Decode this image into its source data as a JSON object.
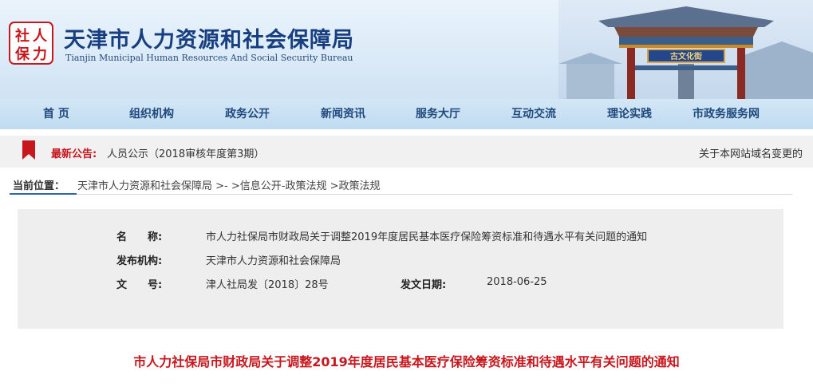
{
  "header": {
    "logo_text": "社人保力",
    "title": "天津市人力资源和社会保障局",
    "subtitle": "Tianjin Municipal Human Resources And Social Security Bureau",
    "gate_sign": "古文化街"
  },
  "nav": {
    "items": [
      {
        "label": "首 页"
      },
      {
        "label": "组织机构"
      },
      {
        "label": "政务公开"
      },
      {
        "label": "新闻资讯"
      },
      {
        "label": "服务大厅"
      },
      {
        "label": "互动交流"
      },
      {
        "label": "理论实践"
      },
      {
        "label": "市政务服务网"
      }
    ]
  },
  "notice": {
    "label": "最新公告:",
    "text": "人员公示（2018审核年度第3期）",
    "text2": "关于本网站域名变更的"
  },
  "breadcrumb": {
    "label": "当前位置：",
    "home": "天津市人力资源和社会保障局",
    "sep1": " >- >",
    "item2": "信息公开-政策法规",
    "sep2": " >",
    "item3": "政策法规"
  },
  "info": {
    "name_label": "名　　称:",
    "name_value": "市人力社保局市财政局关于调整2019年度居民基本医疗保险筹资标准和待遇水平有关问题的通知",
    "org_label": "发布机构:",
    "org_value": "天津市人力资源和社会保障局",
    "doc_label": "文　　号:",
    "doc_value": "津人社局发〔2018〕28号",
    "date_label": "发文日期:",
    "date_value": "2018-06-25"
  },
  "article": {
    "title": "市人力社保局市财政局关于调整2019年度居民基本医疗保险筹资标准和待遇水平有关问题的通知"
  },
  "colors": {
    "brand_blue": "#173f80",
    "nav_text": "#20497e",
    "accent_red": "#c8161d"
  }
}
